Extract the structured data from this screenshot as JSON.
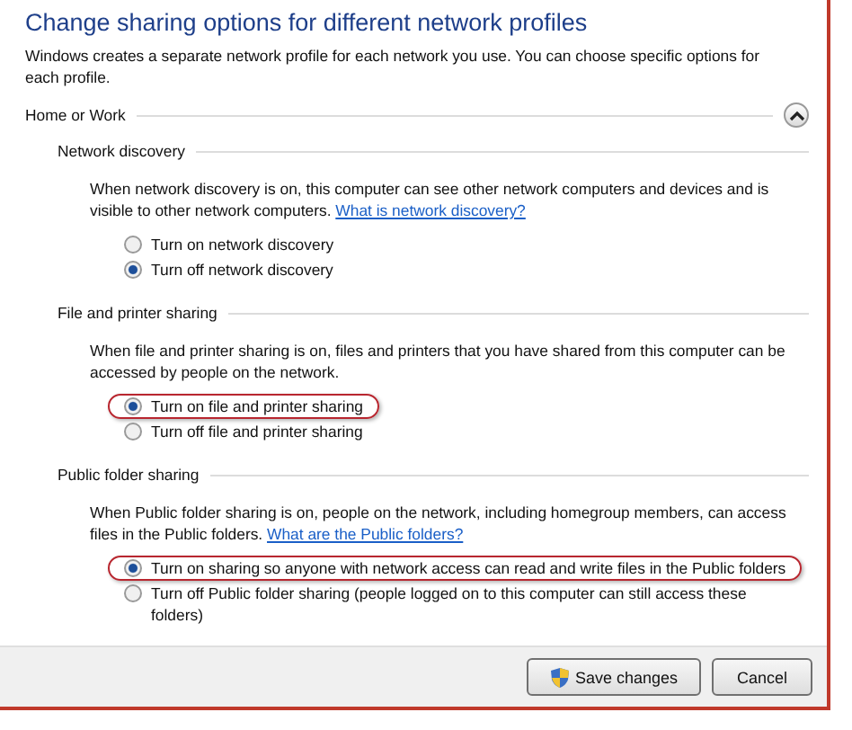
{
  "title": "Change sharing options for different network profiles",
  "intro": "Windows creates a separate network profile for each network you use. You can choose specific options for each profile.",
  "profile": {
    "label": "Home or Work",
    "expanded": true
  },
  "sections": [
    {
      "heading": "Network discovery",
      "description": "When network discovery is on, this computer can see other network computers and devices and is visible to other network computers.",
      "link": "What is network discovery?",
      "options": [
        {
          "label": "Turn on network discovery",
          "selected": false,
          "highlighted": false
        },
        {
          "label": "Turn off network discovery",
          "selected": true,
          "highlighted": false
        }
      ]
    },
    {
      "heading": "File and printer sharing",
      "description": "When file and printer sharing is on, files and printers that you have shared from this computer can be accessed by people on the network.",
      "options": [
        {
          "label": "Turn on file and printer sharing",
          "selected": true,
          "highlighted": true
        },
        {
          "label": "Turn off file and printer sharing",
          "selected": false,
          "highlighted": false
        }
      ]
    },
    {
      "heading": "Public folder sharing",
      "description": "When Public folder sharing is on, people on the network, including homegroup members, can access files in the Public folders.",
      "link": "What are the Public folders?",
      "options": [
        {
          "label": "Turn on sharing so anyone with network access can read and write files in the Public folders",
          "selected": true,
          "highlighted": true
        },
        {
          "label": "Turn off Public folder sharing (people logged on to this computer can still access these folders)",
          "selected": false,
          "highlighted": false
        }
      ]
    }
  ],
  "buttons": [
    {
      "label": "Save changes",
      "kind": "admin"
    },
    {
      "label": "Cancel",
      "kind": "plain"
    }
  ]
}
